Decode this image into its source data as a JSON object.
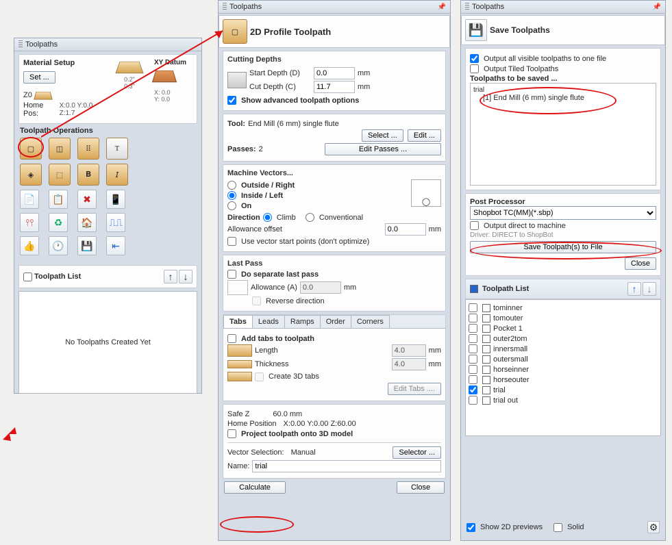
{
  "panel1": {
    "title": "Toolpaths",
    "material_setup": "Material Setup",
    "set_btn": "Set ...",
    "xy_datum": "XY Datum",
    "dim1": "0.2\"",
    "dim2": "0.3\"",
    "z0_label": "Z0",
    "home_pos": "Home Pos:",
    "home_pos_val": "X:0.0 Y:0.0 Z:1.7",
    "coord_x": "X: 0.0",
    "coord_y": "Y: 0.0",
    "ops_title": "Toolpath Operations",
    "toolpath_list": "Toolpath List",
    "no_toolpaths": "No Toolpaths Created Yet"
  },
  "panel2": {
    "title": "Toolpaths",
    "heading": "2D Profile Toolpath",
    "cutting_depths": "Cutting Depths",
    "start_depth": "Start Depth (D)",
    "start_depth_val": "0.0",
    "cut_depth": "Cut Depth (C)",
    "cut_depth_val": "11.7",
    "mm": "mm",
    "show_adv": "Show advanced toolpath options",
    "tool_label": "Tool:",
    "tool_name": "End Mill (6 mm) single flute",
    "select_btn": "Select ...",
    "edit_btn": "Edit ...",
    "passes": "Passes:",
    "passes_val": "2",
    "edit_passes": "Edit Passes ...",
    "machine_vectors": "Machine Vectors...",
    "outside": "Outside / Right",
    "inside": "Inside / Left",
    "on": "On",
    "direction": "Direction",
    "climb": "Climb",
    "conventional": "Conventional",
    "allowance": "Allowance offset",
    "allowance_val": "0.0",
    "use_vector_start": "Use vector start points (don't optimize)",
    "last_pass": "Last Pass",
    "do_separate": "Do separate last pass",
    "allowance_a": "Allowance (A)",
    "allowance_a_val": "0.0",
    "reverse": "Reverse direction",
    "tabs": {
      "tabs": "Tabs",
      "leads": "Leads",
      "ramps": "Ramps",
      "order": "Order",
      "corners": "Corners"
    },
    "add_tabs": "Add tabs to toolpath",
    "length": "Length",
    "length_val": "4.0",
    "thickness": "Thickness",
    "thickness_val": "4.0",
    "create_3d": "Create 3D tabs",
    "edit_tabs": "Edit Tabs ....",
    "safe_z": "Safe Z",
    "safe_z_val": "60.0 mm",
    "home_position": "Home Position",
    "home_position_val": "X:0.00 Y:0.00 Z:60.00",
    "project_3d": "Project toolpath onto 3D model",
    "vector_sel": "Vector Selection:",
    "vector_sel_val": "Manual",
    "selector_btn": "Selector ...",
    "name_label": "Name:",
    "name_val": "trial",
    "calculate": "Calculate",
    "close": "Close"
  },
  "panel3": {
    "title": "Toolpaths",
    "save_heading": "Save Toolpaths",
    "out_all": "Output all visible toolpaths to one file",
    "out_tiled": "Output Tiled Toolpaths",
    "to_be_saved": "Toolpaths to be saved ...",
    "root": "trial",
    "item": "[1] End Mill (6 mm) single flute",
    "post_proc": "Post Processor",
    "pp_value": "Shopbot TC(MM)(*.sbp)",
    "out_direct": "Output direct to machine",
    "driver": "Driver: DIRECT to ShopBot",
    "save_btn": "Save Toolpath(s) to File",
    "close": "Close",
    "list_title": "Toolpath List",
    "items": [
      "tominner",
      "tomouter",
      "Pocket 1",
      "outer2tom",
      "innersmall",
      "outersmall",
      "horseinner",
      "horseouter",
      "trial",
      "trial out"
    ],
    "checked_item": "trial",
    "show_2d": "Show 2D previews",
    "solid": "Solid"
  }
}
